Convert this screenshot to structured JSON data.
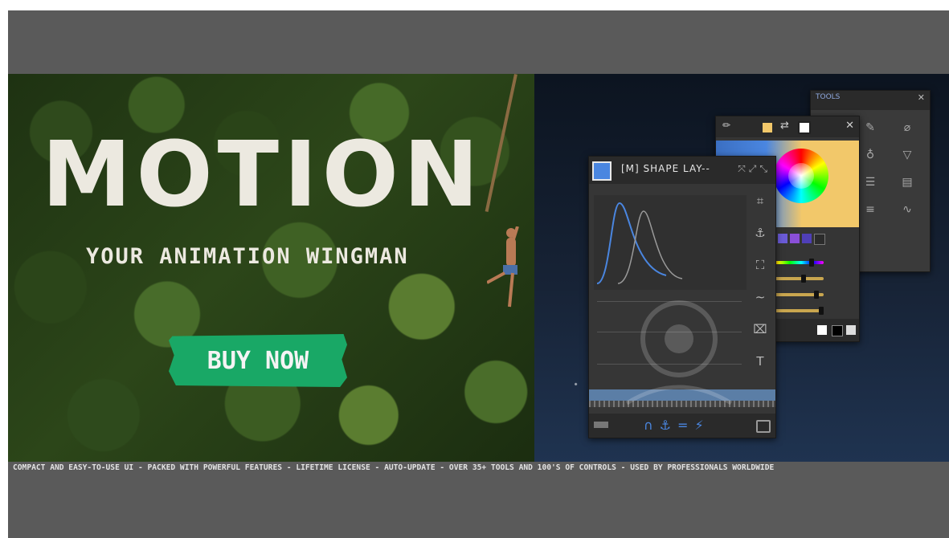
{
  "hero": {
    "title": "MOTION",
    "tagline": "YOUR ANIMATION WINGMAN",
    "cta_label": "BUY NOW",
    "cta_color": "#19a866"
  },
  "tools_panel": {
    "header": "TOOLS",
    "icons": [
      "pin-tool-icon",
      "pen-tool-icon",
      "clip-tool-icon",
      "square-tool-icon",
      "microphone-tool-icon",
      "funnel-tool-icon",
      "diamond-tool-icon",
      "layers-tool-icon",
      "clipboard-tool-icon",
      "grid-tool-icon",
      "stack-tool-icon",
      "dots-tool-icon"
    ]
  },
  "color_panel": {
    "accent_colors": [
      "#4a86e0",
      "#f2c86a"
    ],
    "swatches": [
      "#f2c86a",
      "#6b5bd6",
      "#8a4fd8",
      "#4f3fb8",
      "#2b2b2b"
    ]
  },
  "shape_panel": {
    "title": "[M] SHAPE LAY--",
    "side_icons": [
      "align-icon",
      "anchor-icon",
      "frame-icon",
      "smooth-icon",
      "crop-icon",
      "text-icon"
    ]
  },
  "ticker": {
    "text": "COMPACT AND EASY-TO-USE UI  -  PACKED WITH POWERFUL FEATURES  -  LIFETIME LICENSE  -  AUTO-UPDATE  -  OVER 35+ TOOLS AND 100'S OF CONTROLS  -  USED BY PROFESSIONALS WORLDWIDE"
  }
}
